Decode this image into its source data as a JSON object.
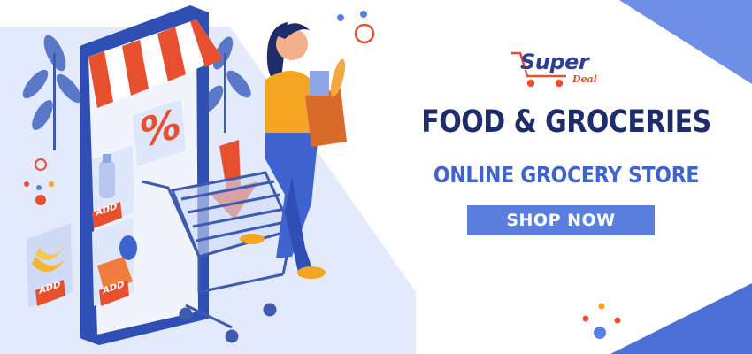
{
  "brand": {
    "name": "Super",
    "tagline": "Deal"
  },
  "headline": "FOOD & GROCERIES",
  "subheadline": "ONLINE GROCERY STORE",
  "cta": {
    "label": "SHOP NOW"
  },
  "phone_screen": {
    "discount_symbol": "%",
    "add_labels": [
      "ADD",
      "ADD",
      "ADD"
    ]
  },
  "colors": {
    "navy": "#1f2c6b",
    "blue": "#3f63cf",
    "button": "#5b7fe0",
    "accent_orange": "#e6502f",
    "light_blue_bg": "#dfe7fb"
  },
  "icons": [
    "shopping-cart-icon",
    "down-arrow-icon",
    "percent-icon",
    "shopping-bag-icon"
  ]
}
